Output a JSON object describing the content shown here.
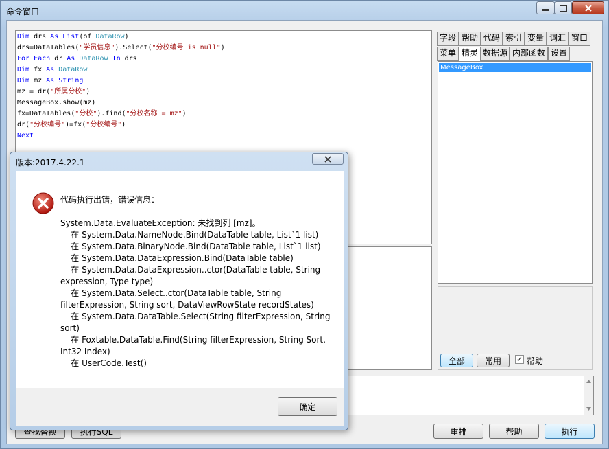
{
  "window": {
    "title": "命令窗口",
    "min_icon": "minimize-icon",
    "max_icon": "maximize-icon",
    "close_icon": "close-icon"
  },
  "code_lines": [
    [
      {
        "t": "Dim",
        "c": "kw"
      },
      {
        "t": " drs "
      },
      {
        "t": "As",
        "c": "kw"
      },
      {
        "t": " "
      },
      {
        "t": "List",
        "c": "kw"
      },
      {
        "t": "(of "
      },
      {
        "t": "DataRow",
        "c": "ty"
      },
      {
        "t": ")"
      }
    ],
    [
      {
        "t": "drs=DataTables("
      },
      {
        "t": "\"学员信息\"",
        "c": "st"
      },
      {
        "t": ").Select("
      },
      {
        "t": "\"分校编号 is null\"",
        "c": "st"
      },
      {
        "t": ")"
      }
    ],
    [
      {
        "t": "For",
        "c": "kw"
      },
      {
        "t": " "
      },
      {
        "t": "Each",
        "c": "kw"
      },
      {
        "t": " dr "
      },
      {
        "t": "As",
        "c": "kw"
      },
      {
        "t": " "
      },
      {
        "t": "DataRow",
        "c": "ty"
      },
      {
        "t": " "
      },
      {
        "t": "In",
        "c": "kw"
      },
      {
        "t": " drs"
      }
    ],
    [
      {
        "t": "Dim",
        "c": "kw"
      },
      {
        "t": " fx "
      },
      {
        "t": "As",
        "c": "kw"
      },
      {
        "t": " "
      },
      {
        "t": "DataRow",
        "c": "ty"
      }
    ],
    [
      {
        "t": "Dim",
        "c": "kw"
      },
      {
        "t": " mz "
      },
      {
        "t": "As",
        "c": "kw"
      },
      {
        "t": " "
      },
      {
        "t": "String",
        "c": "kw"
      }
    ],
    [
      {
        "t": "mz = dr("
      },
      {
        "t": "\"所属分校\"",
        "c": "st"
      },
      {
        "t": ")"
      }
    ],
    [
      {
        "t": "MessageBox.show(mz)"
      }
    ],
    [
      {
        "t": "fx=DataTables("
      },
      {
        "t": "\"分校\"",
        "c": "st"
      },
      {
        "t": ").find("
      },
      {
        "t": "\"分校名称 = mz\"",
        "c": "st"
      },
      {
        "t": ")"
      }
    ],
    [
      {
        "t": "dr("
      },
      {
        "t": "\"分校编号\"",
        "c": "st"
      },
      {
        "t": ")=fx("
      },
      {
        "t": "\"分校编号\"",
        "c": "st"
      },
      {
        "t": ")"
      }
    ],
    [
      {
        "t": "Next",
        "c": "kw"
      }
    ]
  ],
  "tabs_row1": [
    "字段",
    "帮助",
    "代码",
    "索引",
    "变量",
    "词汇",
    "窗口"
  ],
  "tabs_row2": [
    "菜单",
    "精灵",
    "数据源",
    "内部函数",
    "设置"
  ],
  "active_tab": "精灵",
  "right_list": {
    "selected_item": "MessageBox"
  },
  "right_buttons": {
    "all": "全部",
    "common": "常用",
    "help_checkbox": "帮助",
    "help_checked": true,
    "check_mark": "✓"
  },
  "bottom_buttons": {
    "find_replace": "查找替换",
    "exec_sql": "执行SQL",
    "reset": "重排",
    "help": "帮助",
    "run": "执行"
  },
  "dialog": {
    "title": "版本:2017.4.22.1",
    "icon": "error-icon",
    "message": "代码执行出错，错误信息：\n\nSystem.Data.EvaluateException: 未找到列 [mz]。\n    在 System.Data.NameNode.Bind(DataTable table, List`1 list)\n    在 System.Data.BinaryNode.Bind(DataTable table, List`1 list)\n    在 System.Data.DataExpression.Bind(DataTable table)\n    在 System.Data.DataExpression..ctor(DataTable table, String expression, Type type)\n    在 System.Data.Select..ctor(DataTable table, String filterExpression, String sort, DataViewRowState recordStates)\n    在 System.Data.DataTable.Select(String filterExpression, String sort)\n    在 Foxtable.DataTable.Find(String filterExpression, String Sort, Int32 Index)\n    在 UserCode.Test()",
    "ok_label": "确定"
  }
}
